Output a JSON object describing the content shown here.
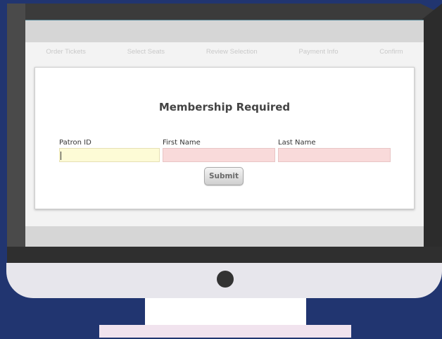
{
  "steps": [
    {
      "label": "Order Tickets"
    },
    {
      "label": "Select Seats"
    },
    {
      "label": "Review Selection"
    },
    {
      "label": "Payment Info"
    },
    {
      "label": "Confirm"
    }
  ],
  "form": {
    "title": "Membership Required",
    "fields": [
      {
        "label": "Patron ID",
        "value": "",
        "state": "focused"
      },
      {
        "label": "First Name",
        "value": "",
        "state": "invalid"
      },
      {
        "label": "Last Name",
        "value": "",
        "state": "invalid"
      }
    ],
    "submit_label": "Submit"
  },
  "colors": {
    "background": "#213570",
    "bezel": "#3b3b3b",
    "invalid_field": "#f9dada",
    "focused_field": "#fdfbd6"
  }
}
